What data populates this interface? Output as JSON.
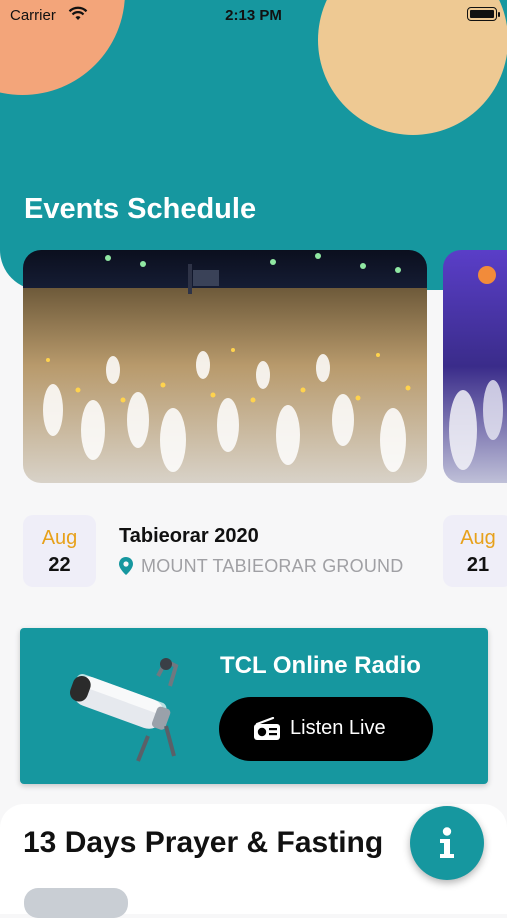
{
  "status_bar": {
    "carrier": "Carrier",
    "time": "2:13 PM"
  },
  "hero": {
    "title": "Events Schedule"
  },
  "events": [
    {
      "month": "Aug",
      "day": "22",
      "name": "Tabieorar 2020",
      "location": "MOUNT TABIEORAR GROUND"
    },
    {
      "month": "Aug",
      "day": "21"
    }
  ],
  "radio": {
    "title": "TCL Online Radio",
    "button_label": "Listen Live"
  },
  "section": {
    "title": "13 Days Prayer & Fasting"
  },
  "fab": {
    "icon": "info-icon"
  },
  "colors": {
    "primary": "#16979f",
    "accent_orange": "#f3a57a",
    "accent_cream": "#eec993",
    "month_color": "#e7a11b"
  }
}
